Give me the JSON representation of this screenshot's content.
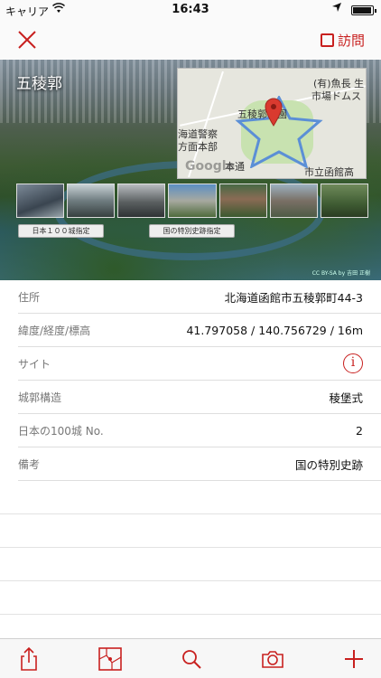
{
  "status_bar": {
    "carrier": "キャリア",
    "time": "16:43"
  },
  "nav": {
    "visit_label": "訪問"
  },
  "hero": {
    "castle_name": "五稜郭",
    "map_labels": {
      "park": "五稜郭公園",
      "shop": "(有)魚長 生",
      "market": "市場ドムス",
      "police1": "海道警察",
      "police2": "方面本部",
      "school": "市立函館高",
      "street": "本通"
    },
    "chips": [
      "日本１００城指定",
      "国の特別史跡指定"
    ],
    "credit": "CC BY-SA by 吉田 正樹"
  },
  "details": [
    {
      "label": "住所",
      "value": "北海道函館市五稜郭町44-3"
    },
    {
      "label": "緯度/経度/標高",
      "value": "41.797058 / 140.756729 / 16m"
    },
    {
      "label": "サイト",
      "value": ""
    },
    {
      "label": "城郭構造",
      "value": "稜堡式"
    },
    {
      "label": "日本の100城 No.",
      "value": "2"
    },
    {
      "label": "備考",
      "value": "国の特別史跡"
    }
  ],
  "accent_color": "#c8201f",
  "icons": [
    "close-icon",
    "checkbox-icon",
    "info-icon",
    "share-icon",
    "map-icon",
    "search-icon",
    "camera-icon",
    "add-icon"
  ]
}
